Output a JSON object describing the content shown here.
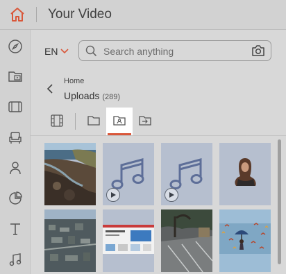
{
  "header": {
    "title": "Your Video",
    "home_icon": "home-icon"
  },
  "sidebar": {
    "items": [
      {
        "name": "compass-icon"
      },
      {
        "name": "media-folder-icon"
      },
      {
        "name": "film-icon"
      },
      {
        "name": "armchair-icon"
      },
      {
        "name": "user-icon"
      },
      {
        "name": "pie-chart-icon"
      },
      {
        "name": "text-icon"
      },
      {
        "name": "music-icon"
      }
    ]
  },
  "toolbar": {
    "language": "EN",
    "search": {
      "placeholder": "Search anything"
    }
  },
  "breadcrumb": {
    "home": "Home",
    "current": "Uploads",
    "count": "(289)"
  },
  "tabs": [
    {
      "name": "video-grid-tab",
      "active": false
    },
    {
      "name": "folder-tab",
      "active": false
    },
    {
      "name": "uploads-folder-tab",
      "active": true
    },
    {
      "name": "import-tab",
      "active": false
    }
  ],
  "colors": {
    "accent": "#d9573a",
    "tile_bg": "#b6bfcf",
    "music_note": "#5d6e98"
  },
  "media": [
    {
      "type": "image",
      "subject": "rocky-coast"
    },
    {
      "type": "audio",
      "subject": "music-note"
    },
    {
      "type": "audio",
      "subject": "music-note"
    },
    {
      "type": "image",
      "subject": "woman-portrait"
    },
    {
      "type": "image",
      "subject": "aerial-city"
    },
    {
      "type": "image",
      "subject": "website-screenshot"
    },
    {
      "type": "image",
      "subject": "parking-lot"
    },
    {
      "type": "image",
      "subject": "umbrella-birds"
    }
  ]
}
